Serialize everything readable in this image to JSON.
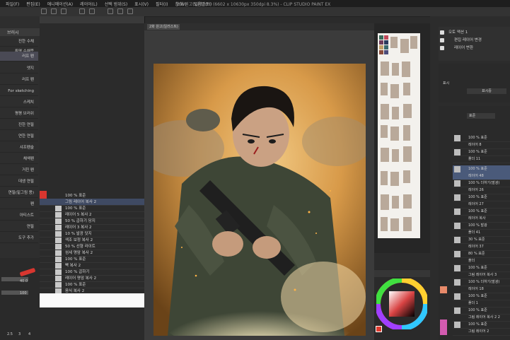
{
  "window": {
    "title": "2화 원고(일러스트) (6602 x 10630px 350dpi 8.3%) - CLIP STUDIO PAINT EX",
    "menu": [
      "파일(F)",
      "편집(E)",
      "애니메이션(A)",
      "레이어(L)",
      "선택 범위(S)",
      "표시(V)",
      "필터(I)",
      "창(W)",
      "도움말(H)"
    ]
  },
  "canvas_tab": "2화 원고(일러스트)",
  "left_panel": {
    "header": "브러시",
    "items": [
      "진한 수채",
      "투명 수채붓",
      "엣지",
      "러프 펜",
      "For sketching",
      "스케치",
      "평평 브러쉬",
      "진한 연필",
      "연한 연필",
      "샤프펜슬",
      "채색펜",
      "거친 펜",
      "데생 연필",
      "연필(밑그림 용)",
      "펜",
      "아티스트",
      "연필",
      "도구 추가"
    ],
    "selected": "러프 펜",
    "size_value": "40.0",
    "opacity_value": "100",
    "bottom_values": [
      "2.5",
      "3",
      "4"
    ]
  },
  "mid_panel": {
    "rows": [
      "100 % 표준",
      "그림 레이어 복사 2",
      "100 % 표준",
      "레이어 5 복사 2",
      "50 % 곱하기 당지",
      "레이어 3 복사 2",
      "10 % 발광 닷지",
      "색조 보정 복사 2",
      "50 % 선형 라이트",
      "섬세 명암 복사 2",
      "100 % 표준",
      "빡 복사 2",
      "100 % 곱하기",
      "레이어 명암 복사 2",
      "100 % 표준",
      "음식 복사 2"
    ]
  },
  "auto_actions": {
    "title": "오토 액션",
    "rows": [
      "오토 액션 1",
      "편집 레이어 변경",
      "레이어 변환"
    ]
  },
  "navigator": {
    "label": "표시",
    "value": "표시중"
  },
  "layer_panel": {
    "blend": "표준",
    "rows": [
      "100 % 표준",
      "레이어 8",
      "100 % 표준",
      "폴더 11",
      "100 % 표준",
      "레이어 48",
      "100 % 더하기(발광)",
      "레이어 26",
      "100 % 표준",
      "레이어 27",
      "100 % 표준",
      "레이어 복사",
      "100 % 발광",
      "폴더 41",
      "30 % 표준",
      "레이어 37",
      "80 % 표준",
      "폴더",
      "100 % 표준",
      "그림 레이어 복사 3",
      "100 % 더하기(발광)",
      "레이어 18",
      "100 % 표준",
      "폴더 1",
      "100 % 표준",
      "그림 레이어 복사 2 2",
      "100 % 표준",
      "그림 레이어 2"
    ],
    "selected_index": 4
  },
  "colors": {
    "accent_red": "#d8362f",
    "selection_blue": "#4a5a7a"
  }
}
